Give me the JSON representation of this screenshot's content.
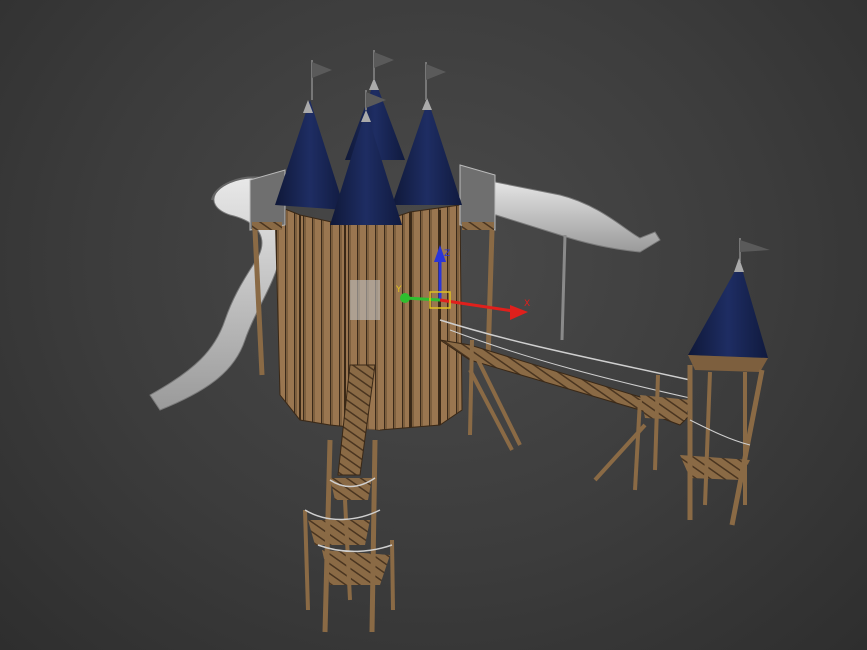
{
  "viewport": {
    "background": "#3d3d3d",
    "model": "castle-playground",
    "gizmo": {
      "x_label": "X",
      "y_label": "Y",
      "z_label": "Z",
      "x_color": "#e0201c",
      "y_color": "#2fbf2f",
      "z_color": "#2a35d8"
    }
  },
  "colors": {
    "roof": "#17234d",
    "wood": "#8a6a45",
    "wood_dark": "#5a4028",
    "slide": "#c7c7c7",
    "flag": "#555555"
  }
}
